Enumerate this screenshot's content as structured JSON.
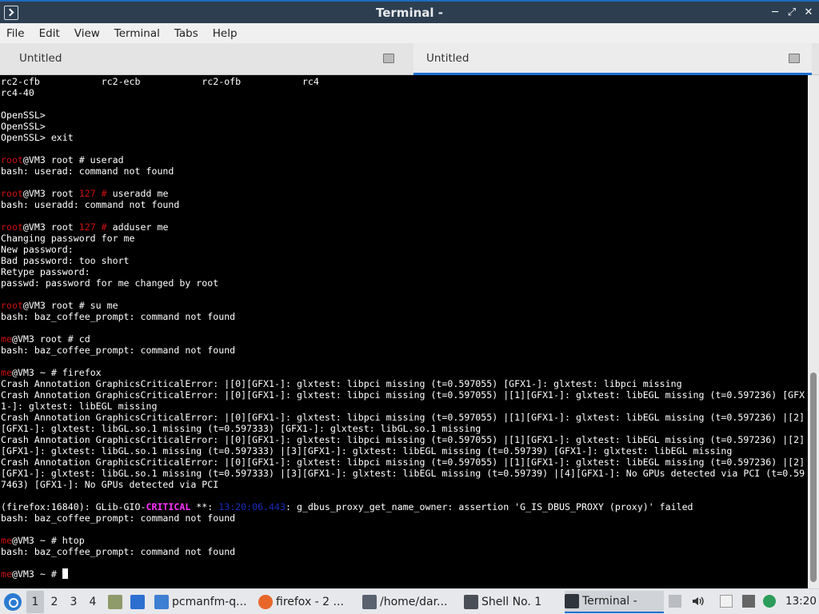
{
  "window": {
    "title": "Terminal -",
    "minimize_glyph": "─",
    "maximize_glyph": "⤢",
    "close_glyph": "✕"
  },
  "menu": [
    "File",
    "Edit",
    "View",
    "Terminal",
    "Tabs",
    "Help"
  ],
  "tabs": [
    {
      "label": "Untitled",
      "active": false
    },
    {
      "label": "Untitled",
      "active": true
    }
  ],
  "terminal": {
    "lines": [
      [
        {
          "t": "rc2-cfb           rc2-ecb           rc2-ofb           rc4"
        }
      ],
      [
        {
          "t": "rc4-40"
        }
      ],
      [
        {
          "t": ""
        }
      ],
      [
        {
          "t": "OpenSSL>"
        }
      ],
      [
        {
          "t": "OpenSSL>"
        }
      ],
      [
        {
          "t": "OpenSSL> exit"
        }
      ],
      [
        {
          "t": ""
        }
      ],
      [
        {
          "t": "root",
          "c": "red"
        },
        {
          "t": "@VM3 root # userad"
        }
      ],
      [
        {
          "t": "bash: userad: command not found"
        }
      ],
      [
        {
          "t": ""
        }
      ],
      [
        {
          "t": "root",
          "c": "red"
        },
        {
          "t": "@VM3 root "
        },
        {
          "t": "127 #",
          "c": "red"
        },
        {
          "t": " useradd me"
        }
      ],
      [
        {
          "t": "bash: useradd: command not found"
        }
      ],
      [
        {
          "t": ""
        }
      ],
      [
        {
          "t": "root",
          "c": "red"
        },
        {
          "t": "@VM3 root "
        },
        {
          "t": "127 #",
          "c": "red"
        },
        {
          "t": " adduser me"
        }
      ],
      [
        {
          "t": "Changing password for me"
        }
      ],
      [
        {
          "t": "New password:"
        }
      ],
      [
        {
          "t": "Bad password: too short"
        }
      ],
      [
        {
          "t": "Retype password:"
        }
      ],
      [
        {
          "t": "passwd: password for me changed by root"
        }
      ],
      [
        {
          "t": ""
        }
      ],
      [
        {
          "t": "root",
          "c": "red"
        },
        {
          "t": "@VM3 root # su me"
        }
      ],
      [
        {
          "t": "bash: baz_coffee_prompt: command not found"
        }
      ],
      [
        {
          "t": ""
        }
      ],
      [
        {
          "t": "me",
          "c": "red"
        },
        {
          "t": "@VM3 root # cd"
        }
      ],
      [
        {
          "t": "bash: baz_coffee_prompt: command not found"
        }
      ],
      [
        {
          "t": ""
        }
      ],
      [
        {
          "t": "me",
          "c": "red"
        },
        {
          "t": "@VM3 ~ # firefox"
        }
      ],
      [
        {
          "t": "Crash Annotation GraphicsCriticalError: |[0][GFX1-]: glxtest: libpci missing (t=0.597055) [GFX1-]: glxtest: libpci missing"
        }
      ],
      [
        {
          "t": "Crash Annotation GraphicsCriticalError: |[0][GFX1-]: glxtest: libpci missing (t=0.597055) |[1][GFX1-]: glxtest: libEGL missing (t=0.597236) [GFX"
        }
      ],
      [
        {
          "t": "1-]: glxtest: libEGL missing"
        }
      ],
      [
        {
          "t": "Crash Annotation GraphicsCriticalError: |[0][GFX1-]: glxtest: libpci missing (t=0.597055) |[1][GFX1-]: glxtest: libEGL missing (t=0.597236) |[2]"
        }
      ],
      [
        {
          "t": "[GFX1-]: glxtest: libGL.so.1 missing (t=0.597333) [GFX1-]: glxtest: libGL.so.1 missing"
        }
      ],
      [
        {
          "t": "Crash Annotation GraphicsCriticalError: |[0][GFX1-]: glxtest: libpci missing (t=0.597055) |[1][GFX1-]: glxtest: libEGL missing (t=0.597236) |[2]"
        }
      ],
      [
        {
          "t": "[GFX1-]: glxtest: libGL.so.1 missing (t=0.597333) |[3][GFX1-]: glxtest: libEGL missing (t=0.59739) [GFX1-]: glxtest: libEGL missing"
        }
      ],
      [
        {
          "t": "Crash Annotation GraphicsCriticalError: |[0][GFX1-]: glxtest: libpci missing (t=0.597055) |[1][GFX1-]: glxtest: libEGL missing (t=0.597236) |[2]"
        }
      ],
      [
        {
          "t": "[GFX1-]: glxtest: libGL.so.1 missing (t=0.597333) |[3][GFX1-]: glxtest: libEGL missing (t=0.59739) |[4][GFX1-]: No GPUs detected via PCI (t=0.59"
        }
      ],
      [
        {
          "t": "7463) [GFX1-]: No GPUs detected via PCI"
        }
      ],
      [
        {
          "t": ""
        }
      ],
      [
        {
          "t": "(firefox:16840): GLib-GIO-"
        },
        {
          "t": "CRITICAL",
          "c": "magenta"
        },
        {
          "t": " **: "
        },
        {
          "t": "13:20:06.443",
          "c": "blue"
        },
        {
          "t": ": g_dbus_proxy_get_name_owner: assertion 'G_IS_DBUS_PROXY (proxy)' failed"
        }
      ],
      [
        {
          "t": "bash: baz_coffee_prompt: command not found"
        }
      ],
      [
        {
          "t": ""
        }
      ],
      [
        {
          "t": "me",
          "c": "red"
        },
        {
          "t": "@VM3 ~ # htop"
        }
      ],
      [
        {
          "t": "bash: baz_coffee_prompt: command not found"
        }
      ],
      [
        {
          "t": ""
        }
      ],
      [
        {
          "t": "me",
          "c": "red"
        },
        {
          "t": "@VM3 ~ # "
        }
      ]
    ]
  },
  "taskbar": {
    "workspaces": [
      "1",
      "2",
      "3",
      "4"
    ],
    "active_workspace": "1",
    "tasks": [
      {
        "label": "pcmanfm-q...",
        "icon": "folder-icon",
        "color": "#3d7fd1"
      },
      {
        "label": "firefox - 2 ...",
        "icon": "firefox-icon",
        "color": "#e8662a"
      },
      {
        "label": "/home/dar...",
        "icon": "text-editor-icon",
        "color": "#5a6270"
      },
      {
        "label": "Shell No. 1",
        "icon": "terminal-icon",
        "color": "#4a4f57"
      },
      {
        "label": "Terminal -",
        "icon": "terminal-icon",
        "color": "#2f353d",
        "active": true
      }
    ],
    "clock": "13:20"
  },
  "colors": {
    "titlebar": "#2c3e50",
    "accent": "#1e6fd0",
    "prompt_user": "#cc1111"
  }
}
